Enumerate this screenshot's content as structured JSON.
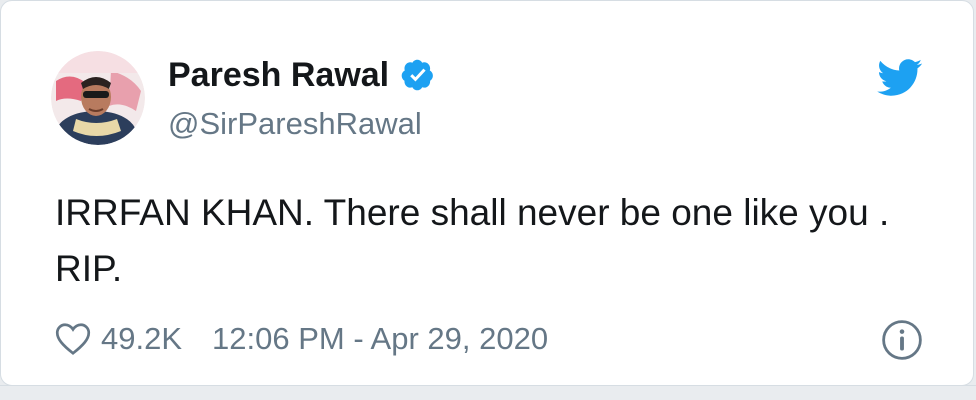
{
  "tweet": {
    "author": {
      "display_name": "Paresh Rawal",
      "handle": "@SirPareshRawal",
      "verified": true
    },
    "text_line1": "IRRFAN KHAN. There shall never be one like you .",
    "text_line2": "RIP.",
    "likes": "49.2K",
    "timestamp": "12:06 PM - Apr 29, 2020",
    "icons": {
      "avatar": "avatar",
      "verified": "verified-badge-icon",
      "brand": "twitter-bird-icon",
      "like": "heart-icon",
      "info": "info-icon"
    },
    "colors": {
      "twitter_blue": "#1da1f2",
      "text": "#14171a",
      "muted": "#657786"
    }
  }
}
